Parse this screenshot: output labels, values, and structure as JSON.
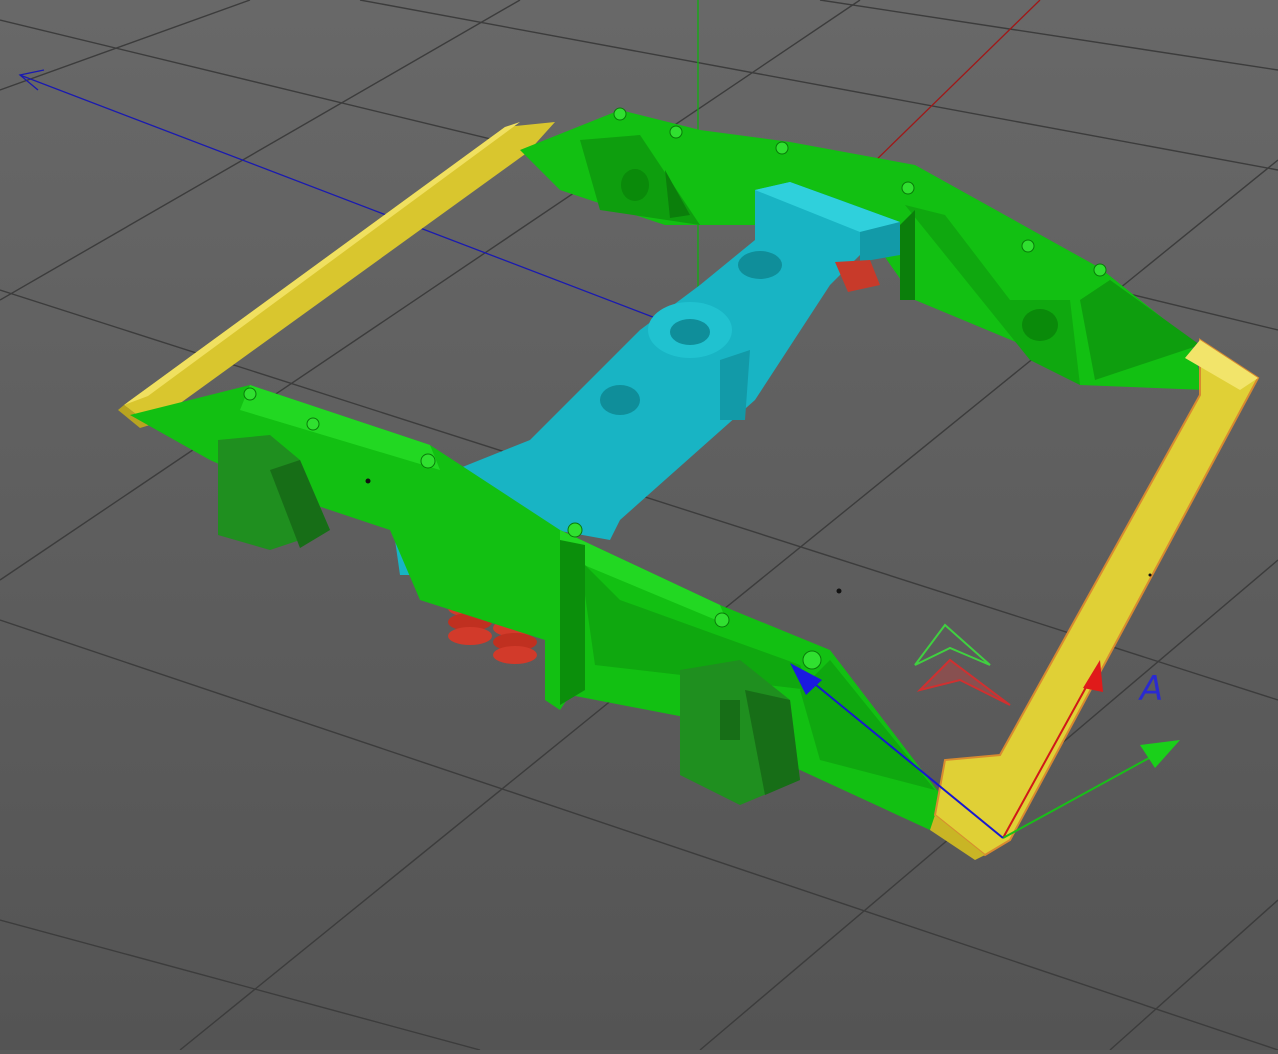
{
  "viewport": {
    "background": "#5e5e5e",
    "grid_color": "#3a3a3a"
  },
  "axes": {
    "x_color": "#a01010",
    "y_color": "#10b010",
    "z_color": "#1010b0"
  },
  "model": {
    "parts": [
      {
        "name": "side-frame-left",
        "color": "#11c411"
      },
      {
        "name": "side-frame-right",
        "color": "#11c411"
      },
      {
        "name": "bolster",
        "color": "#17b3c2"
      },
      {
        "name": "brake-beam-left",
        "color": "#e3d23a"
      },
      {
        "name": "brake-beam-right",
        "color": "#e3d23a"
      },
      {
        "name": "springs",
        "color": "#d23a2a"
      },
      {
        "name": "journal-box",
        "color": "#1f8f1f"
      }
    ]
  },
  "gizmo": {
    "axis_letter": "A"
  }
}
